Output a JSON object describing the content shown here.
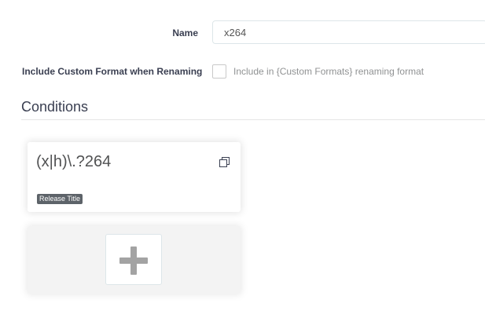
{
  "form": {
    "name_label": "Name",
    "name_value": "x264",
    "include_label": "Include Custom Format when Renaming",
    "include_help": "Include in {Custom Formats} renaming format",
    "include_checked": false
  },
  "conditions": {
    "title": "Conditions",
    "items": [
      {
        "value": "(x|h)\\.?264",
        "tag": "Release Title"
      }
    ]
  },
  "icons": {
    "clone": "clone-icon",
    "add": "plus-icon"
  },
  "colors": {
    "tag_bg": "#5d6369",
    "plus": "#a3a3a3",
    "add_card_bg": "#f3f3f3"
  }
}
